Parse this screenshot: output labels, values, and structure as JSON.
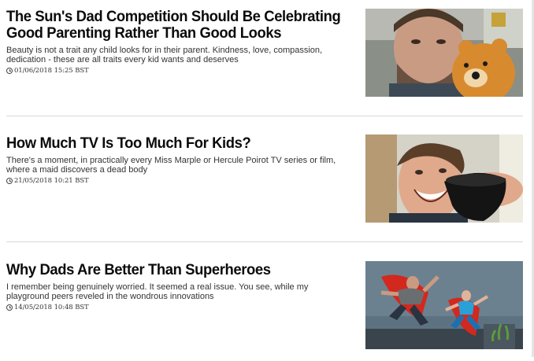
{
  "articles": [
    {
      "headline": "The Sun's Dad Competition Should Be Celebrating Good Parenting Rather Than Good Looks",
      "summary": "Beauty is not a trait any child looks for in their parent. Kindness, love, compassion, dedication - these are all traits every kid wants and deserves",
      "timestamp": "01/06/2018 15:25 BST",
      "thumbnail_icon": "man-with-teddy-bear-photo"
    },
    {
      "headline": "How Much TV Is Too Much For Kids?",
      "summary": "There's a moment, in practically every Miss Marple or Hercule Poirot TV series or film, where a maid discovers a dead body",
      "timestamp": "21/05/2018 10:21 BST",
      "thumbnail_icon": "man-with-wine-glass-photo"
    },
    {
      "headline": "Why Dads Are Better Than Superheroes",
      "summary": "I remember being genuinely worried. It seemed a real issue. You see, while my playground peers reveled in the wondrous innovations",
      "timestamp": "14/05/2018 10:48 BST",
      "thumbnail_icon": "dad-and-child-superhero-capes-photo"
    }
  ]
}
